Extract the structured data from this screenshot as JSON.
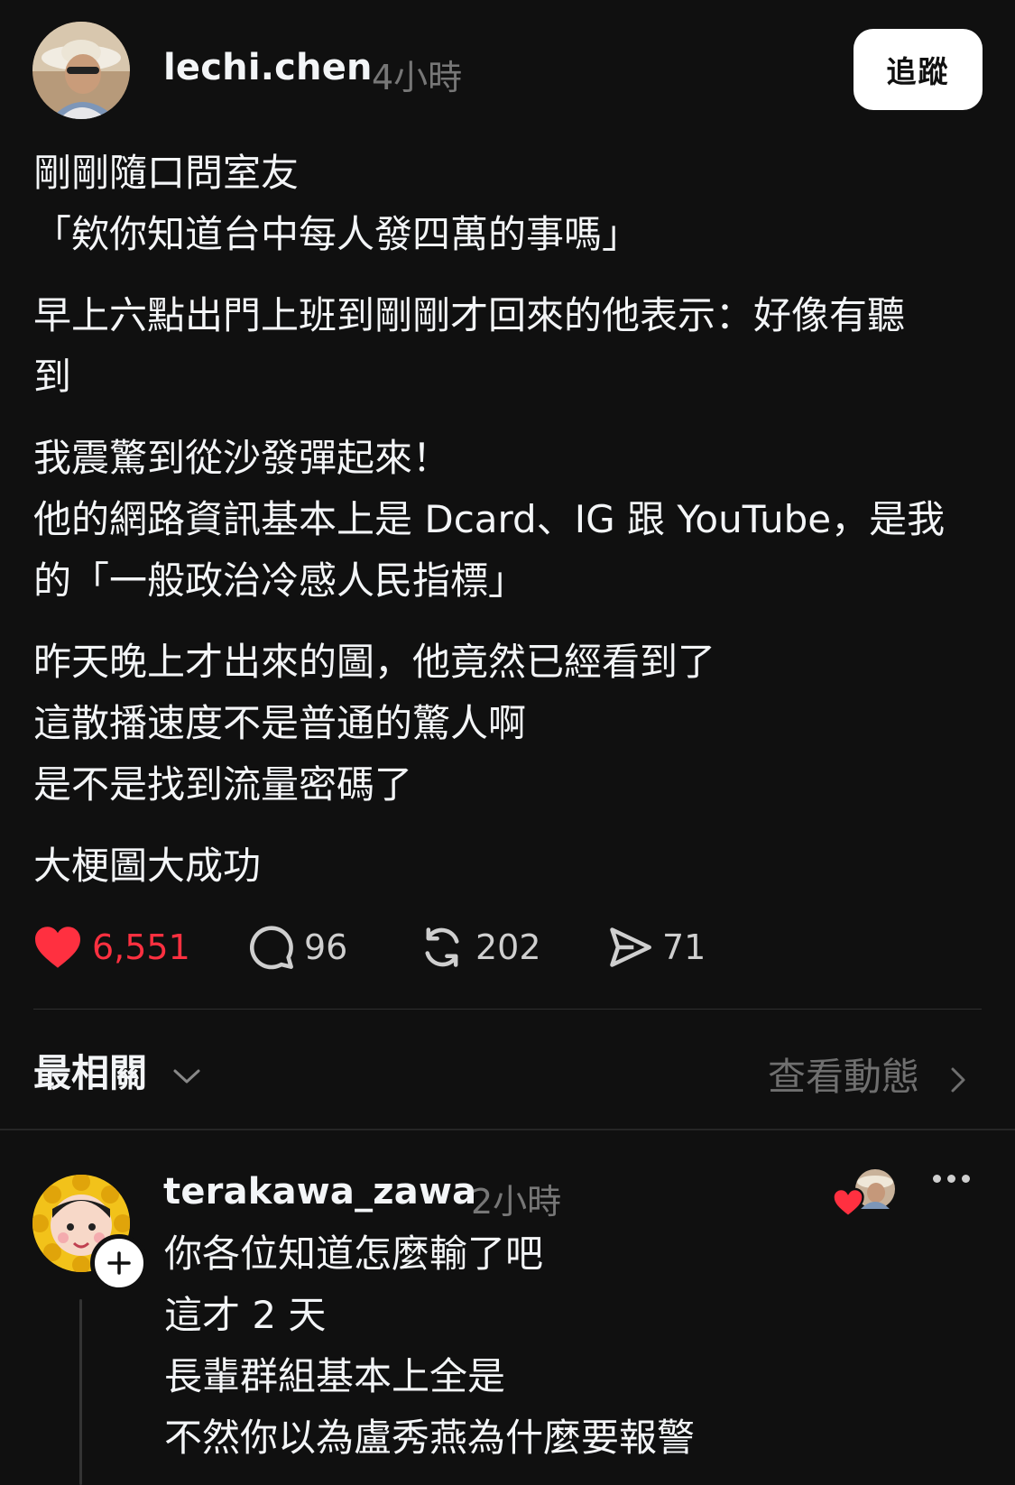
{
  "post": {
    "username": "lechi.chen",
    "time": "4小時",
    "follow_label": "追蹤",
    "paragraphs": [
      [
        "剛剛隨口問室友",
        "「欸你知道台中每人發四萬的事嗎」"
      ],
      [
        "早上六點出門上班到剛剛才回來的他表示：好像有聽",
        "到"
      ],
      [
        "我震驚到從沙發彈起來！",
        "他的網路資訊基本上是 Dcard、IG 跟 YouTube，是我",
        "的「一般政治冷感人民指標」"
      ],
      [
        "昨天晚上才出來的圖，他竟然已經看到了",
        "這散播速度不是普通的驚人啊",
        "是不是找到流量密碼了"
      ],
      [
        "大梗圖大成功"
      ]
    ],
    "actions": {
      "likes": "6,551",
      "comments": "96",
      "reposts": "202",
      "shares": "71"
    }
  },
  "sort_bar": {
    "sort_label": "最相關",
    "activity_label": "查看動態"
  },
  "comment": {
    "username": "terakawa_zawa",
    "time": "2小時",
    "lines": [
      "你各位知道怎麼輸了吧",
      "這才 2 天",
      "長輩群組基本上全是",
      "不然你以為盧秀燕為什麼要報警"
    ]
  },
  "colors": {
    "background": "#101010",
    "like_red": "#ff3040",
    "muted_gray": "#777777"
  },
  "icons": [
    "heart-icon",
    "comment-icon",
    "repost-icon",
    "share-icon",
    "chevron-down-icon",
    "chevron-right-icon",
    "plus-icon",
    "more-icon"
  ]
}
